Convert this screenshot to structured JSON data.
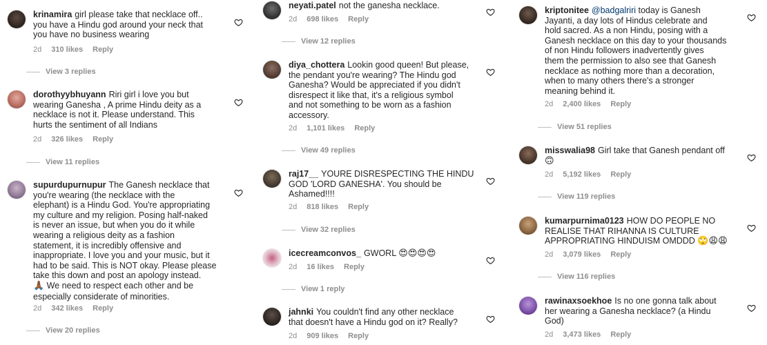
{
  "col1": {
    "c1": {
      "user": "krinamira",
      "text": "girl please take that necklace off..\nyou have a Hindu god around your neck that\nyou have no business wearing",
      "time": "2d",
      "likes": "310 likes",
      "reply": "Reply",
      "view": "View 3 replies"
    },
    "c2": {
      "user": "dorothyybhuyann",
      "text": "Riri girl i love you but\nwearing Ganesha , A prime Hindu deity as a\nnecklace is not it. Please understand. This\nhurts the sentiment of all Indians",
      "time": "2d",
      "likes": "326 likes",
      "reply": "Reply",
      "view": "View 11 replies"
    },
    "c3": {
      "user": "supurdupurnupur",
      "text": "The Ganesh necklace that\nyou're wearing (the necklace with the\nelephant) is a Hindu God. You're appropriating\nmy culture and my religion. Posing half-naked\nis never an issue, but when you do it while\nwearing a religious deity as a fashion\nstatement, it is incredibly offensive and\ninappropriate. I love you and your music, but it\nhad to be said. This is NOT okay. Please please\ntake this down and post an apology instead.",
      "text_emoji": "🙏🏾",
      "text_tail": "We need to respect each other and be\nespecially considerate of minorities.",
      "time": "2d",
      "likes": "342 likes",
      "reply": "Reply",
      "view": "View 20 replies"
    }
  },
  "col2": {
    "c1": {
      "user": "neyati.patel",
      "text": "not the ganesha necklace.",
      "time": "2d",
      "likes": "698 likes",
      "reply": "Reply",
      "view": "View 12 replies"
    },
    "c2": {
      "user": "diya_chottera",
      "text": "Lookin good queen! But please,\nthe pendant you're wearing? The Hindu god\nGanesha? Would be appreciated if you didn't\ndisrespect it like that, it's a religious symbol\nand not something to be worn as a fashion\naccessory.",
      "time": "2d",
      "likes": "1,101 likes",
      "reply": "Reply",
      "view": "View 49 replies"
    },
    "c3": {
      "user": "raj17__",
      "text": "YOURE DISRESPECTING THE HINDU\nGOD 'LORD GANESHA'. You should be\nAshamed!!!!",
      "time": "2d",
      "likes": "818 likes",
      "reply": "Reply",
      "view": "View 32 replies"
    },
    "c4": {
      "user": "icecreamconvos_",
      "text": "GWORL",
      "emojis": "😍😍😍😍",
      "time": "2d",
      "likes": "16 likes",
      "reply": "Reply",
      "view": "View 1 reply"
    },
    "c5": {
      "user": "jahnki",
      "text": "You couldn't find any other necklace\nthat doesn't have a Hindu god on it? Really?",
      "time": "2d",
      "likes": "909 likes",
      "reply": "Reply"
    }
  },
  "col3": {
    "c1": {
      "user": "kriptonitee",
      "mention": "@badgalriri",
      "text": " today is Ganesh\nJayanti, a day lots of Hindus celebrate and\nhold sacred. As a non Hindu, posing with a\nGanesh necklace on this day to your thousands\nof non Hindu followers inadvertently gives\nthem the permission to also see that Ganesh\nnecklace as nothing more than a decoration,\nwhen to many others there's a stronger\nmeaning behind it.",
      "time": "2d",
      "likes": "2,400 likes",
      "reply": "Reply",
      "view": "View 51 replies"
    },
    "c2": {
      "user": "misswalia98",
      "text": "Girl take that Ganesh pendant off",
      "emojis": "🙃",
      "time": "2d",
      "likes": "5,192 likes",
      "reply": "Reply",
      "view": "View 119 replies"
    },
    "c3": {
      "user": "kumarpurnima0123",
      "text": "HOW DO PEOPLE NO\nREALISE THAT RIHANNA IS CULTURE\nAPPROPRIATING HINDUISM OMDDD",
      "emojis": "🙄😩😩",
      "time": "2d",
      "likes": "3,079 likes",
      "reply": "Reply",
      "view": "View 116 replies"
    },
    "c4": {
      "user": "rawinaxsoekhoe",
      "text": "Is no one gonna talk about\nher wearing a Ganesha necklace? (a Hindu\nGod)",
      "time": "2d",
      "likes": "3,473 likes",
      "reply": "Reply"
    }
  },
  "colors": {
    "text": "#262626",
    "muted": "#8e8e8e",
    "mention": "#00376b"
  }
}
